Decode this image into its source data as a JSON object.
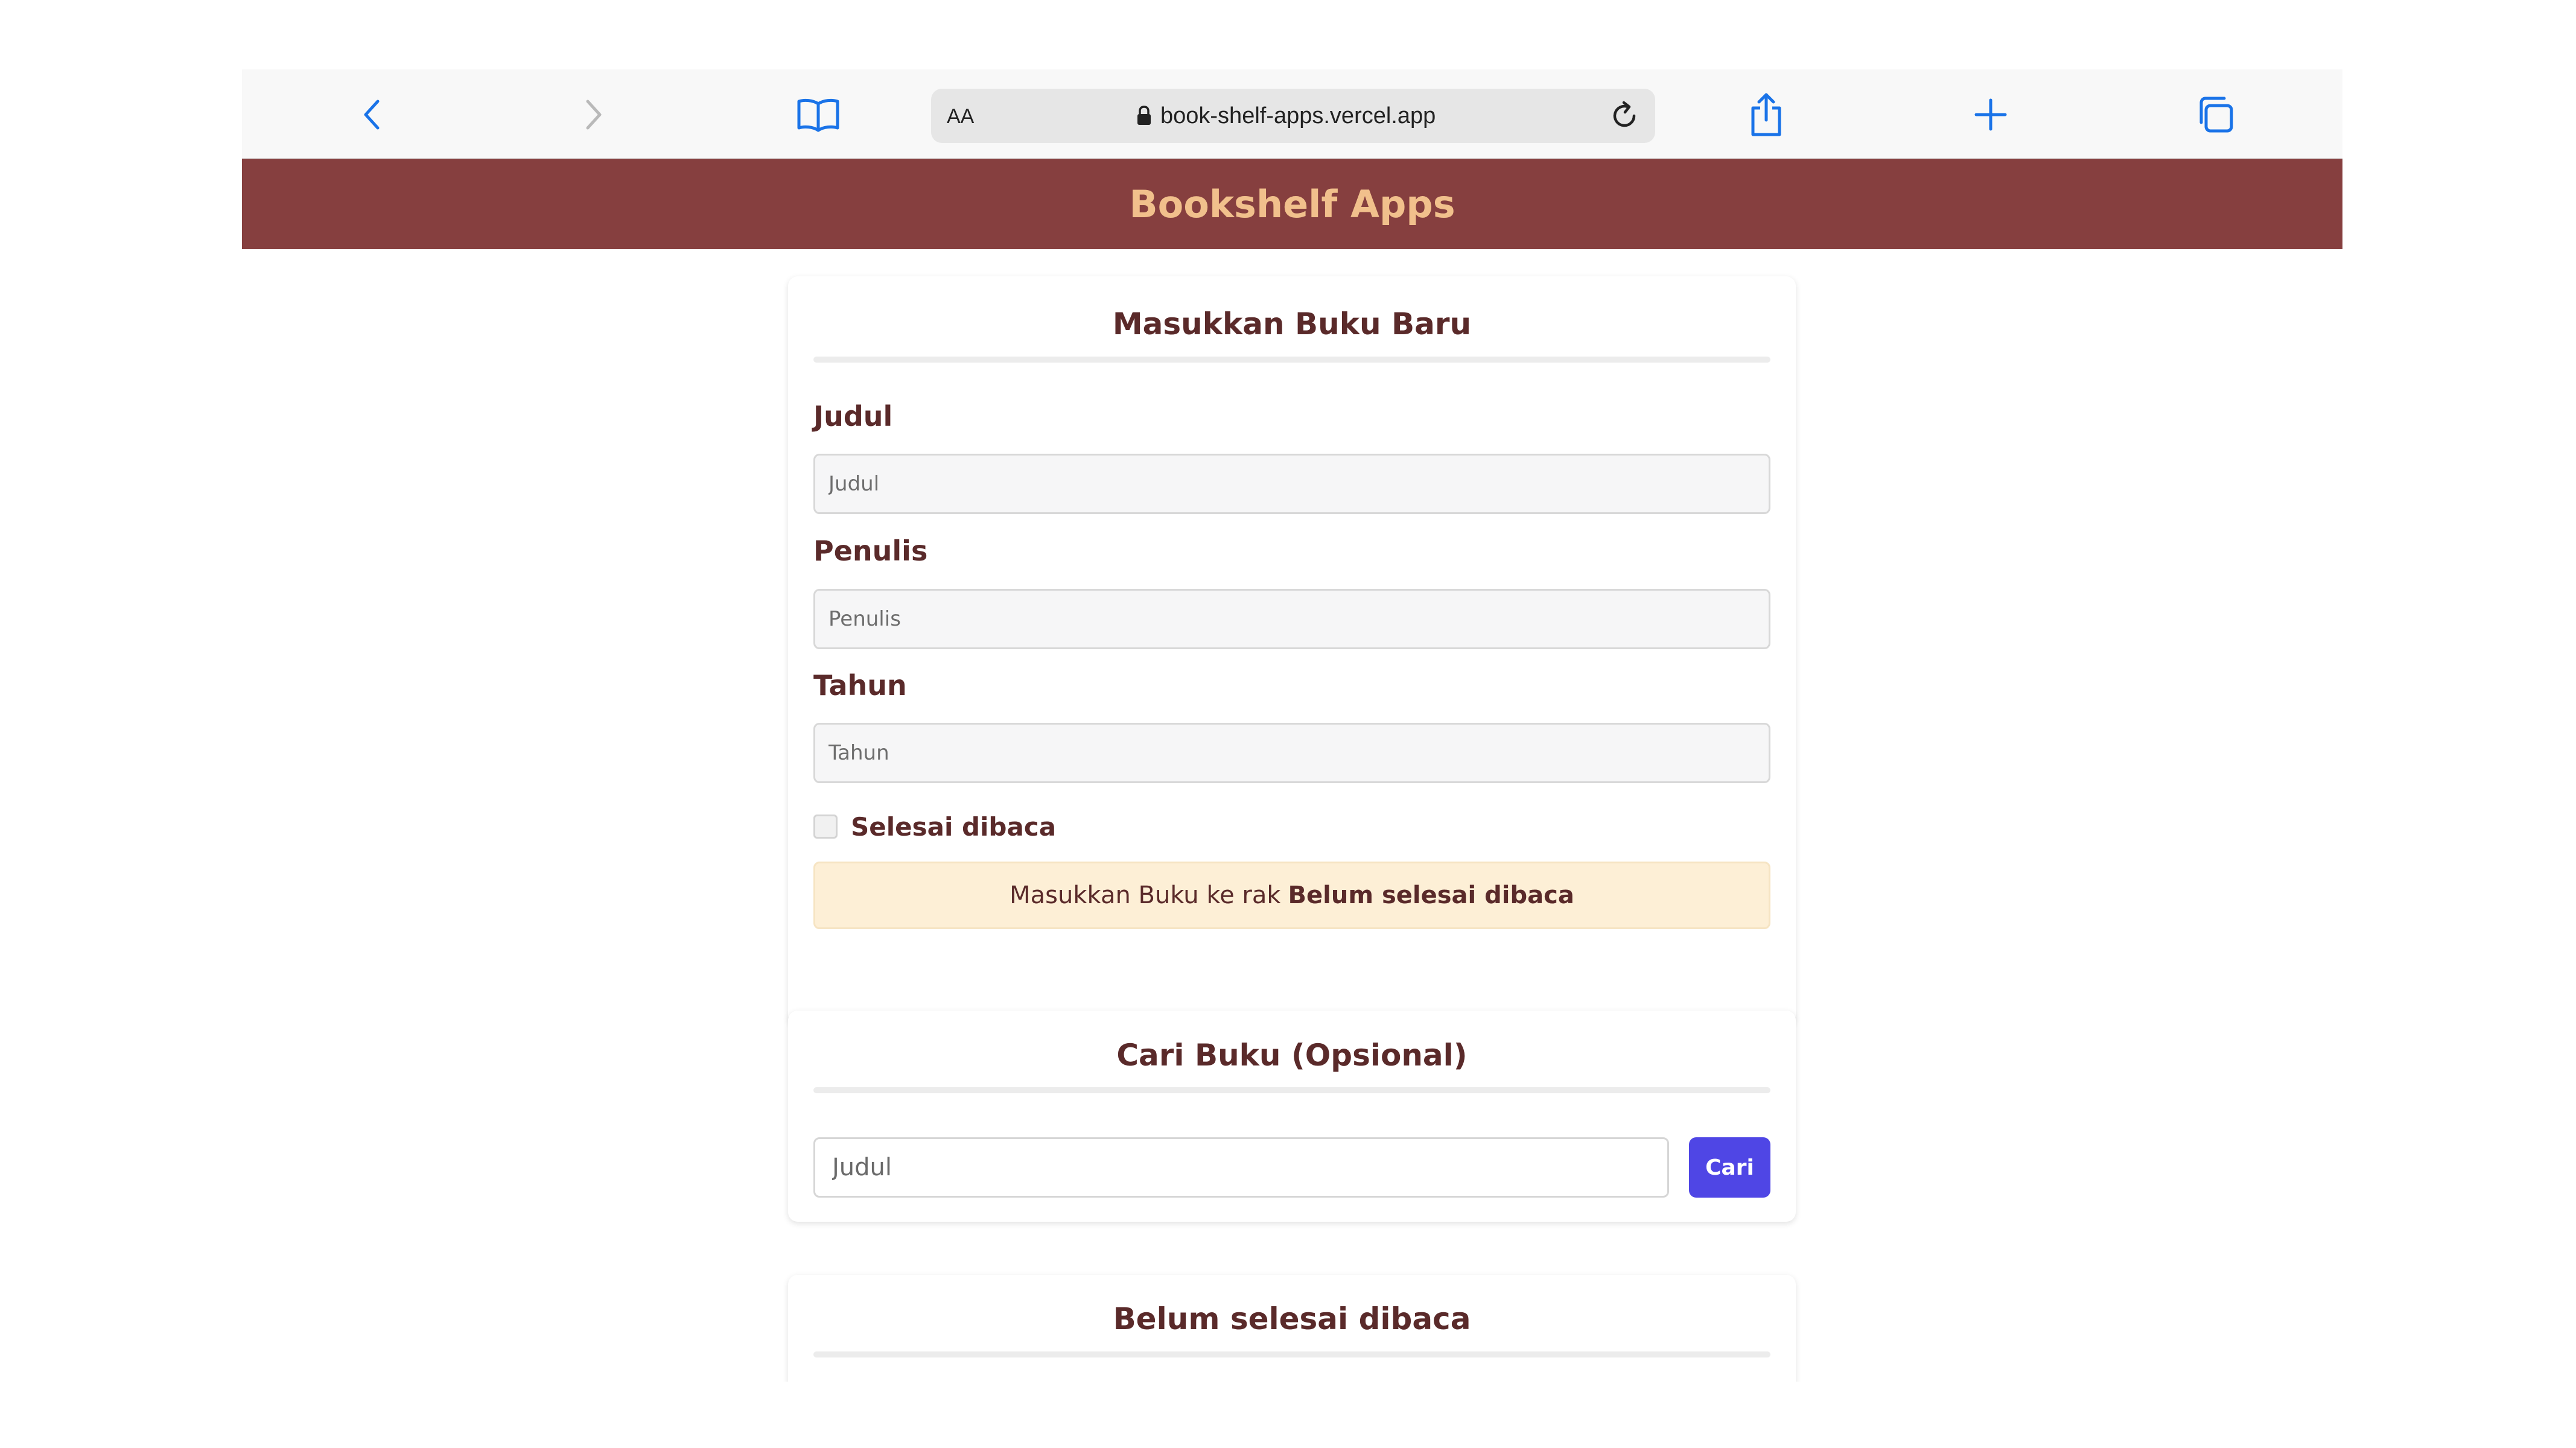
{
  "browser": {
    "aa_label": "AA",
    "url": "book-shelf-apps.vercel.app",
    "icon_color": "#1a73e8",
    "icons": {
      "back": "chevron-left-icon",
      "forward": "chevron-right-icon",
      "bookmarks": "open-book-icon",
      "lock": "lock-icon",
      "reload": "reload-icon",
      "share": "share-icon",
      "new_tab": "plus-icon",
      "tabs": "tabs-icon"
    }
  },
  "header": {
    "title": "Bookshelf Apps",
    "background_color": "#863f3f",
    "title_color": "#f1c08c"
  },
  "add_book_form": {
    "title": "Masukkan Buku Baru",
    "fields": [
      {
        "label": "Judul",
        "placeholder": "Judul",
        "value": ""
      },
      {
        "label": "Penulis",
        "placeholder": "Penulis",
        "value": ""
      },
      {
        "label": "Tahun",
        "placeholder": "Tahun",
        "value": ""
      }
    ],
    "checkbox_label": "Selesai dibaca",
    "checkbox_checked": false,
    "submit_prefix": "Masukkan Buku ke rak",
    "submit_target": "Belum selesai dibaca"
  },
  "search": {
    "title": "Cari Buku (Opsional)",
    "placeholder": "Judul",
    "value": "",
    "button_label": "Cari",
    "button_color": "#4f46e5"
  },
  "unread_shelf": {
    "title": "Belum selesai dibaca"
  }
}
